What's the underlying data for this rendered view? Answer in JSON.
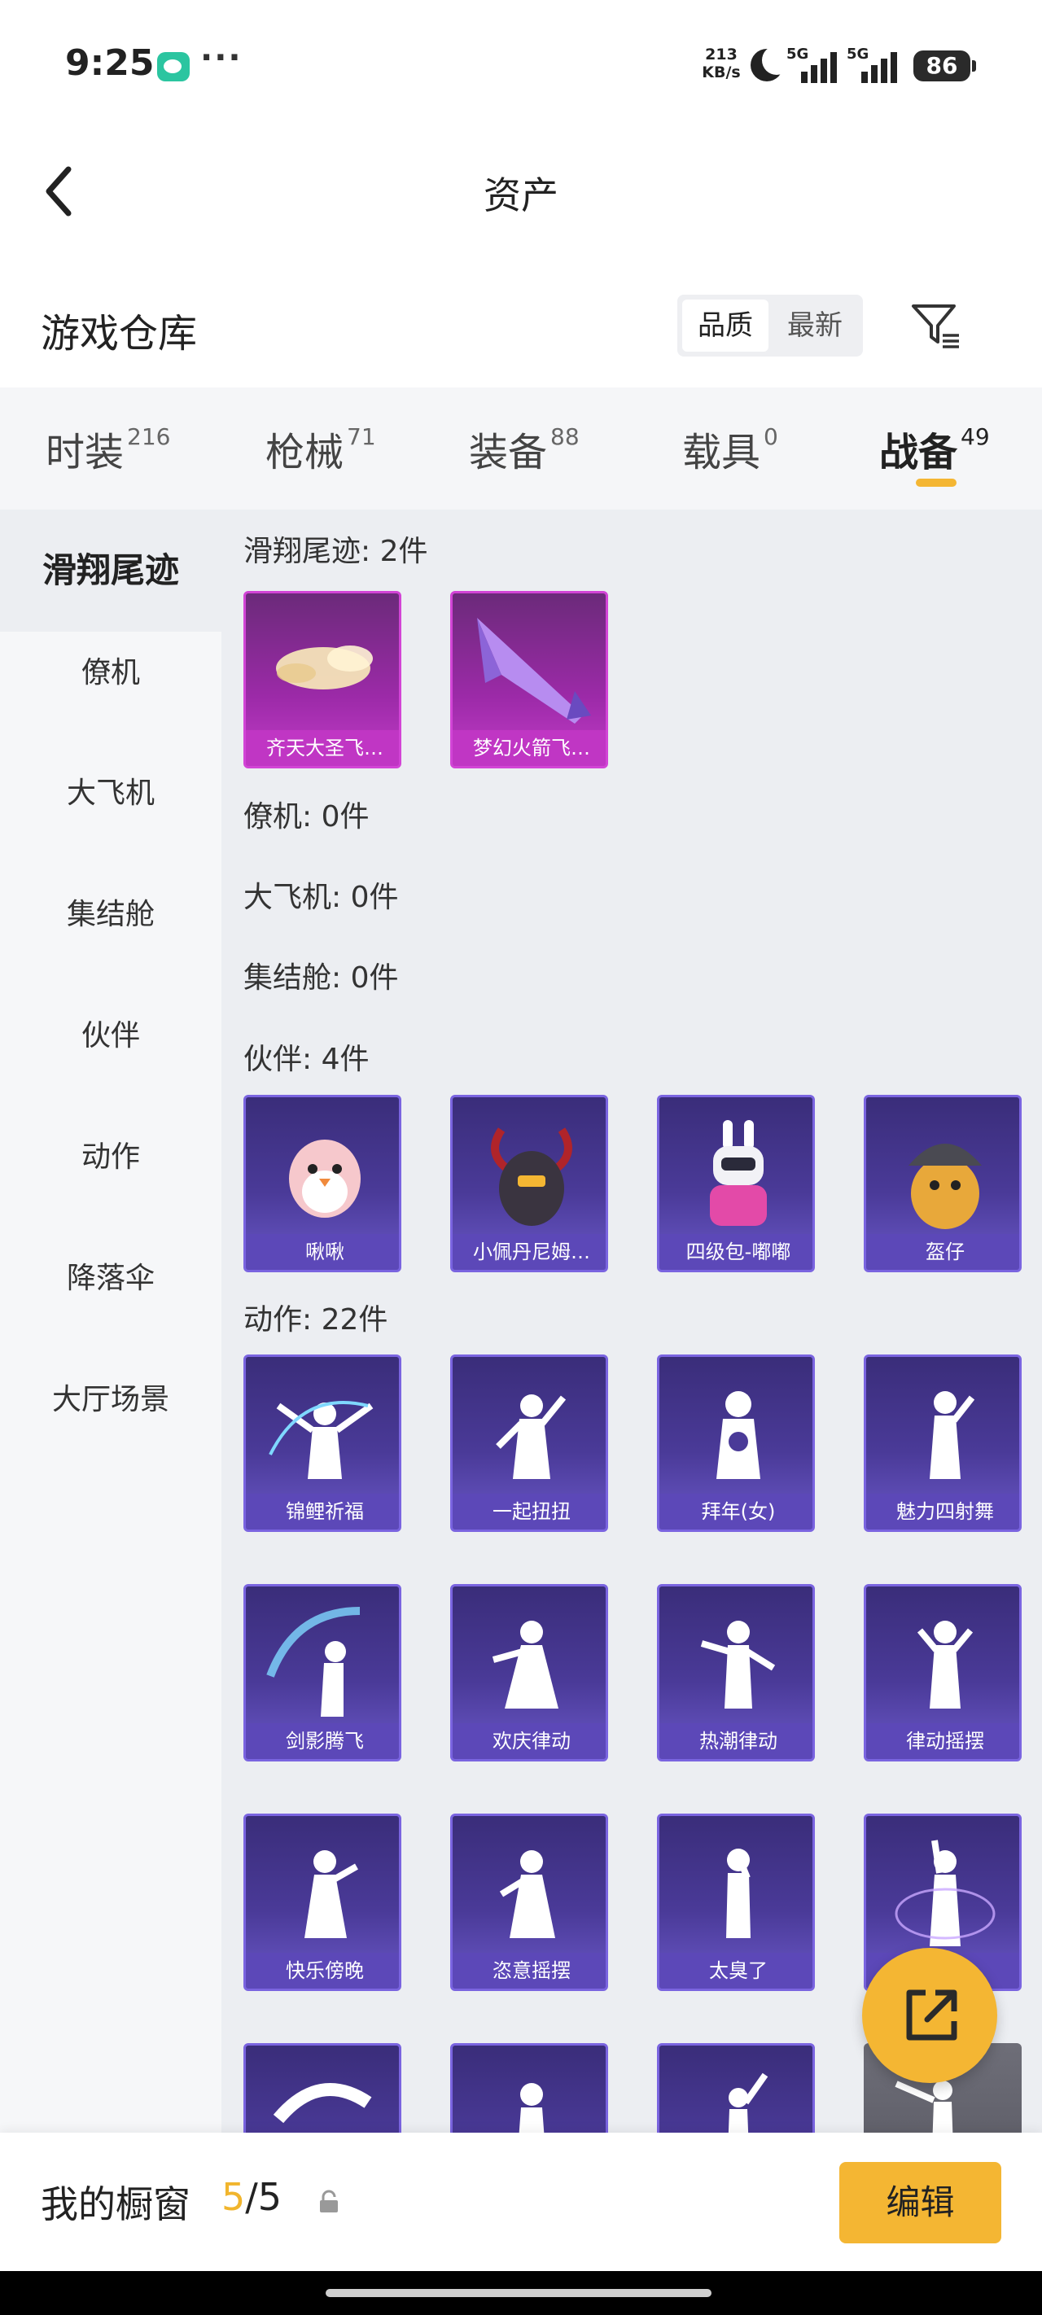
{
  "status_bar": {
    "time": "9:25",
    "more": "···",
    "net_speed_value": "213",
    "net_speed_unit": "KB/s",
    "sim1_label": "5G",
    "sim2_label": "5G",
    "battery": "86"
  },
  "header": {
    "title": "资产"
  },
  "warehouse": {
    "title": "游戏仓库",
    "sort_options": [
      "品质",
      "最新"
    ]
  },
  "category_tabs": [
    {
      "label": "时装",
      "count": "216"
    },
    {
      "label": "枪械",
      "count": "71"
    },
    {
      "label": "装备",
      "count": "88"
    },
    {
      "label": "载具",
      "count": "0"
    },
    {
      "label": "战备",
      "count": "49"
    }
  ],
  "sidebar": {
    "items": [
      "滑翔尾迹",
      "僚机",
      "大飞机",
      "集结舱",
      "伙伴",
      "动作",
      "降落伞",
      "大厅场景"
    ]
  },
  "sections": {
    "glide_trails": {
      "title": "滑翔尾迹: 2件",
      "items": [
        "齐天大圣飞…",
        "梦幻火箭飞…"
      ]
    },
    "wingman": {
      "title": "僚机: 0件"
    },
    "big_plane": {
      "title": "大飞机: 0件"
    },
    "rally_pod": {
      "title": "集结舱: 0件"
    },
    "companions": {
      "title": "伙伴: 4件",
      "items": [
        "啾啾",
        "小佩丹尼姆…",
        "四级包-嘟嘟",
        "盔仔"
      ]
    },
    "emotes": {
      "title": "动作: 22件",
      "items": [
        "锦鲤祈福",
        "一起扭扭",
        "拜年(女)",
        "魅力四射舞",
        "剑影腾飞",
        "欢庆律动",
        "热潮律动",
        "律动摇摆",
        "快乐傍晚",
        "恣意摇摆",
        "太臭了",
        ""
      ]
    }
  },
  "bottom_bar": {
    "label": "我的橱窗",
    "current": "5",
    "total": "/5",
    "edit": "编辑"
  },
  "colors": {
    "accent": "#f4b633",
    "pink_card": "#c036c4",
    "purple_card": "#5c48b8"
  }
}
